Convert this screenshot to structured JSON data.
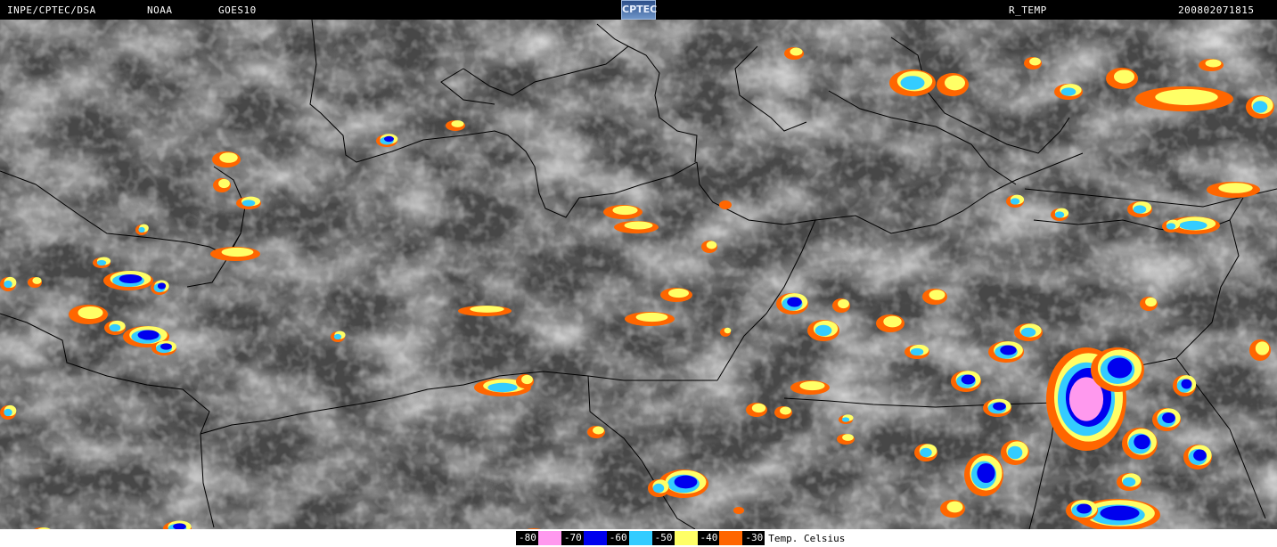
{
  "header": {
    "left": "INPE/CPTEC/DSA",
    "agency": "NOAA",
    "satellite": "GOES10",
    "logo": "CPTEC",
    "product": "R_TEMP",
    "timestamp": "200802071815"
  },
  "legend": {
    "items": [
      {
        "label": "-80",
        "color": "#ff99ee"
      },
      {
        "label": "-70",
        "color": "#0000ee"
      },
      {
        "label": "-60",
        "color": "#33ccff"
      },
      {
        "label": "-50",
        "color": "#ffff66"
      },
      {
        "label": "-40",
        "color": "#ff6600"
      },
      {
        "label": "-30",
        "color": null
      }
    ],
    "unit": "Temp. Celsius"
  },
  "map": {
    "background": "#4a4a4a",
    "cloud_color": "#9a9a9a",
    "border_color": "#000000"
  }
}
